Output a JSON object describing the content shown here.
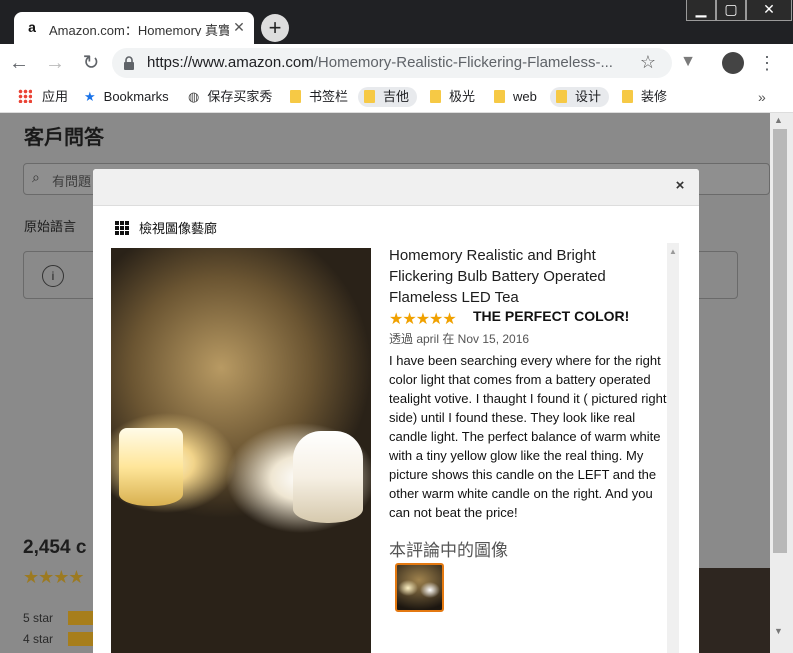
{
  "browser": {
    "tab_title": "Amazon.com：Homemory 真實",
    "tab_favicon": "a",
    "new_tab_symbol": "+",
    "url_host": "https://www.amazon.com",
    "url_path": "/Homemory-Realistic-Flickering-Flameless-...",
    "window_controls": {
      "minimize": "▁",
      "maximize": "▢",
      "close": "✕"
    }
  },
  "bookmarks": [
    {
      "label": "应用",
      "icon": "apps-grid-icon"
    },
    {
      "label": "Bookmarks",
      "icon": "star-icon"
    },
    {
      "label": "保存买家秀",
      "icon": "globe-icon"
    },
    {
      "label": "书签栏",
      "icon": "folder-icon"
    },
    {
      "label": "吉他",
      "icon": "folder-icon"
    },
    {
      "label": "极光",
      "icon": "folder-icon"
    },
    {
      "label": "web",
      "icon": "folder-icon"
    },
    {
      "label": "设计",
      "icon": "folder-icon"
    },
    {
      "label": "装修",
      "icon": "folder-icon"
    }
  ],
  "bookmarks_more": "»",
  "background_page": {
    "heading": "客戶問答",
    "search_placeholder": "有問題",
    "original_language_label": "原始語言",
    "ratings_count": "2,454 c",
    "five_star": "5 star",
    "four_star": "4 star"
  },
  "modal": {
    "close_label": "×",
    "gallery_link": "檢視圖像藝廊",
    "product_title": "Homemory Realistic and Bright Flickering Bulb Battery Operated Flameless LED Tea",
    "review": {
      "stars": "★★★★★",
      "rating": 5,
      "headline": "THE PERFECT COLOR!",
      "byline": "透過 april 在 Nov 15, 2016",
      "body": "I have been searching every where for the right color light that comes from a battery operated tealight votive. I thaught I found it ( pictured right side) until I found these. They look like real candle light. The perfect balance of warm white with a tiny yellow glow like the real thing. My picture shows this candle on the LEFT and the other warm white candle on the right. And you can not beat the price!",
      "images_label": "本評論中的圖像"
    }
  },
  "colors": {
    "star": "#f0a100",
    "thumb_border": "#e47911",
    "folder": "#f6c945"
  }
}
